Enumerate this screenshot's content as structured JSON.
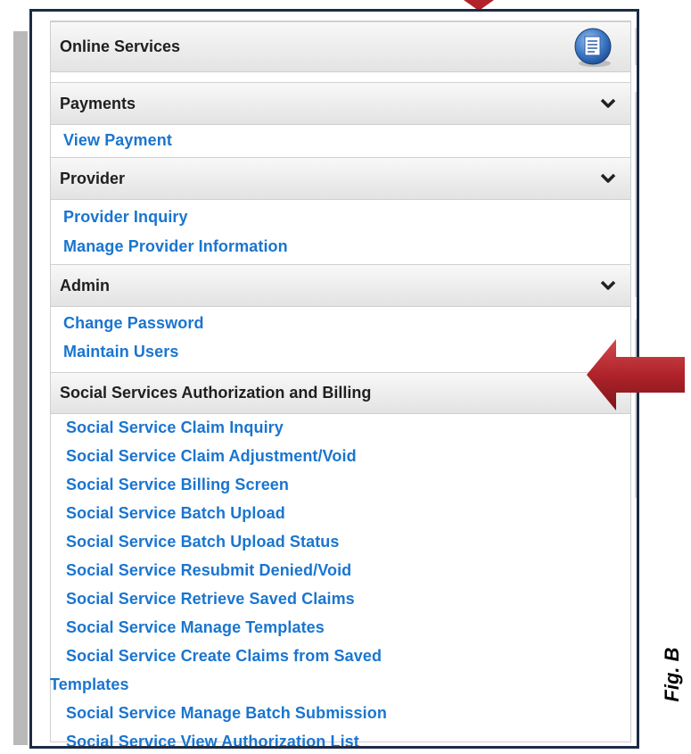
{
  "menu": {
    "title": "Online Services",
    "sections": [
      {
        "title": "Payments",
        "links": [
          "View Payment"
        ]
      },
      {
        "title": "Provider",
        "links": [
          "Provider Inquiry",
          "Manage Provider Information"
        ]
      },
      {
        "title": "Admin",
        "links": [
          "Change Password",
          "Maintain Users"
        ]
      },
      {
        "title": "Social Services Authorization and Billing",
        "links": [
          "Social Service Claim Inquiry",
          "Social Service Claim Adjustment/Void",
          "Social Service Billing Screen",
          "Social Service Batch Upload",
          "Social Service Batch Upload Status",
          "Social Service Resubmit Denied/Void",
          "Social Service Retrieve Saved Claims",
          "Social Service Manage Templates",
          "Social Service Create Claims from Saved",
          "Templates",
          "Social Service Manage Batch Submission",
          "Social Service View Authorization List"
        ]
      }
    ]
  },
  "annotation": {
    "figure_label": "Fig. B"
  },
  "icons": {
    "header_icon": "document-icon",
    "pointer": "arrow-left-icon",
    "top_pointer": "arrow-down-icon"
  },
  "colors": {
    "link": "#1a75cf",
    "frame": "#1c2b44",
    "arrow": "#b0232a"
  }
}
